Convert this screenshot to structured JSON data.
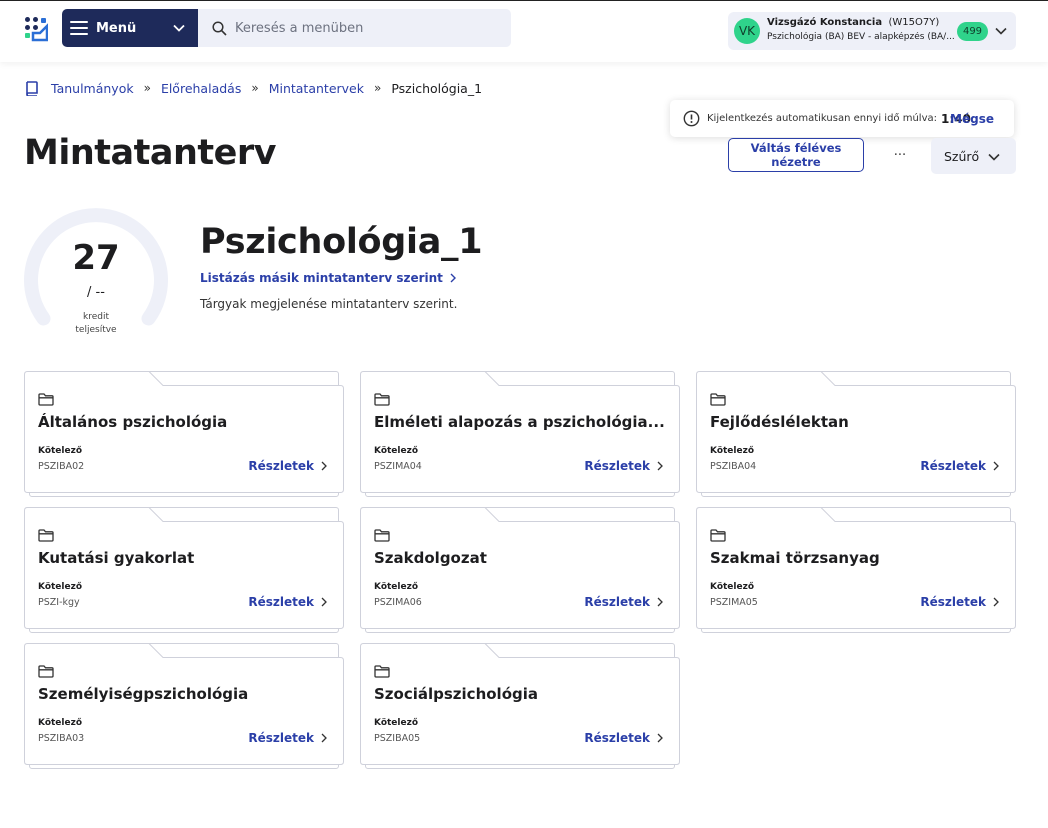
{
  "header": {
    "menu_label": "Menü",
    "search_placeholder": "Keresés a menüben",
    "user_name": "Vizsgázó Konstancia",
    "user_code": "(W15O7Y)",
    "user_initials": "VK",
    "user_program": "Pszichológia (BA) BÉV - alapképzés (BA/...",
    "badge_count": "499"
  },
  "breadcrumb": {
    "items": [
      "Tanulmányok",
      "Előrehaladás",
      "Mintatantervek"
    ],
    "current": "Pszichológia_1"
  },
  "toast": {
    "message": "Kijelentkezés automatikusan ennyi idő múlva:",
    "time": "1:40",
    "cancel_label": "Mégse"
  },
  "page": {
    "title": "Mintatanterv",
    "switch_label": "Váltás féléves nézetre",
    "more_label": "···",
    "filter_label": "Szűrő"
  },
  "gauge": {
    "value": "27",
    "total": "/ --",
    "caption_line1": "kredit",
    "caption_line2": "teljesítve"
  },
  "curriculum": {
    "title": "Pszichológia_1",
    "alt_link": "Listázás másik mintatanterv szerint",
    "description": "Tárgyak megjelenése mintatanterv szerint."
  },
  "cards": [
    {
      "title": "Általános pszichológia",
      "type": "Kötelező",
      "code": "PSZIBA02",
      "details": "Részletek"
    },
    {
      "title": "Elméleti alapozás a pszichológia...",
      "type": "Kötelező",
      "code": "PSZIMA04",
      "details": "Részletek"
    },
    {
      "title": "Fejlődéslélektan",
      "type": "Kötelező",
      "code": "PSZIBA04",
      "details": "Részletek"
    },
    {
      "title": "Kutatási gyakorlat",
      "type": "Kötelező",
      "code": "PSZI-kgy",
      "details": "Részletek"
    },
    {
      "title": "Szakdolgozat",
      "type": "Kötelező",
      "code": "PSZIMA06",
      "details": "Részletek"
    },
    {
      "title": "Szakmai törzsanyag",
      "type": "Kötelező",
      "code": "PSZIMA05",
      "details": "Részletek"
    },
    {
      "title": "Személyiségpszichológia",
      "type": "Kötelező",
      "code": "PSZIBA03",
      "details": "Részletek"
    },
    {
      "title": "Szociálpszichológia",
      "type": "Kötelező",
      "code": "PSZIBA05",
      "details": "Részletek"
    }
  ],
  "colors": {
    "primary": "#2b3fa8",
    "navy": "#1e2a5a",
    "accent_green": "#2fd38b",
    "surface": "#eef0f8"
  }
}
